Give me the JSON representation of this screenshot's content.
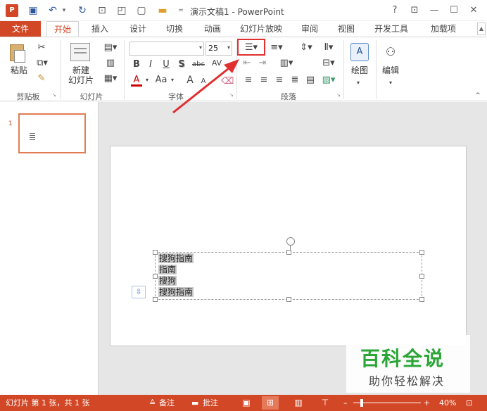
{
  "window": {
    "title": "演示文稿1 - PowerPoint",
    "app_icon": "P",
    "help": "?",
    "restore_ribbon": "⊡",
    "minimize": "—",
    "maximize": "☐",
    "close": "✕"
  },
  "quick_access": {
    "save_icon": "💾",
    "undo_icon": "↶",
    "undo_dd": "▾",
    "redo_icon": "↻",
    "startshow_icon": "⊞",
    "preview_icon": "🔍",
    "new_icon": "🗋",
    "open_icon": "📂",
    "customize": "="
  },
  "tabs": {
    "file": "文件",
    "items": [
      "开始",
      "插入",
      "设计",
      "切换",
      "动画",
      "幻灯片放映",
      "审阅",
      "视图",
      "开发工具",
      "加载项"
    ],
    "scroll": "▲"
  },
  "ribbon": {
    "clipboard": {
      "paste": "粘贴",
      "group": "剪贴板"
    },
    "slides": {
      "new_slide_line1": "新建",
      "new_slide_line2": "幻灯片",
      "group": "幻灯片"
    },
    "font": {
      "name_value": "",
      "size_value": "25",
      "bold": "B",
      "italic": "I",
      "underline": "U",
      "shadow": "S",
      "strike": "abc",
      "spacing": "AV",
      "color": "A",
      "case": "Aa",
      "grow": "A",
      "shrink": "A",
      "group": "字体"
    },
    "paragraph": {
      "group": "段落"
    },
    "drawing": {
      "label": "绘图"
    },
    "editing": {
      "label": "编辑"
    }
  },
  "textbox": {
    "lines": [
      "搜狗指南",
      "指南",
      "搜狗",
      "搜狗指南"
    ]
  },
  "watermark": {
    "title": "百科全说",
    "subtitle": "助你轻松解决"
  },
  "status": {
    "slide_info": "幻灯片 第 1 张，共 1 张",
    "notes": "备注",
    "comments": "批注",
    "zoom_minus": "–",
    "zoom_plus": "+",
    "zoom_level": "40%"
  },
  "colors": {
    "accent": "#d24726",
    "highlight": "#e03030",
    "watermark_green": "#2aa536"
  }
}
